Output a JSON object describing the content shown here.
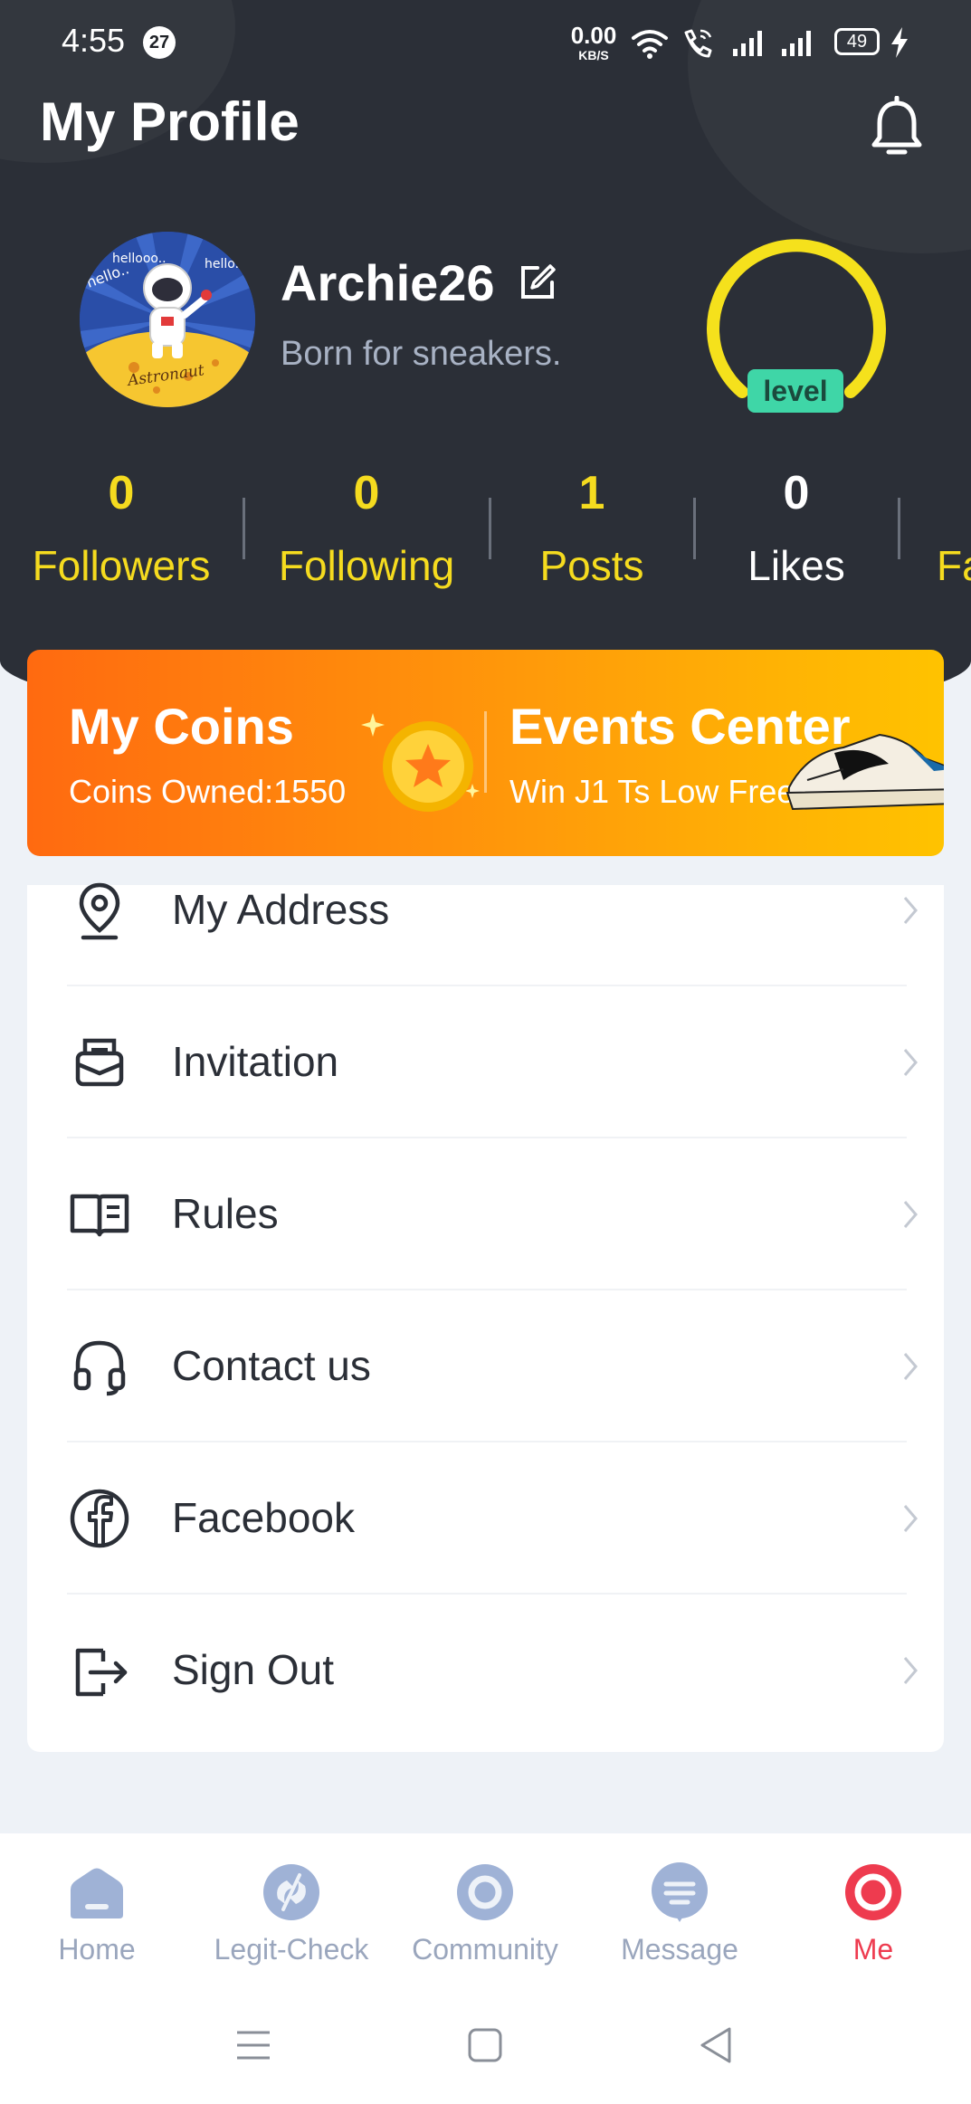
{
  "status_bar": {
    "time": "4:55",
    "notification_count": "27",
    "net_speed_value": "0.00",
    "net_speed_unit": "KB/S",
    "battery": "49"
  },
  "header": {
    "title": "My Profile"
  },
  "profile": {
    "username": "Archie26",
    "bio": "Born for sneakers.",
    "level_label": "level",
    "avatar_texts": [
      "hellooo..",
      "hello..",
      "hello..",
      "Astronaut"
    ]
  },
  "stats": [
    {
      "value": "0",
      "label": "Followers"
    },
    {
      "value": "0",
      "label": "Following"
    },
    {
      "value": "1",
      "label": "Posts"
    },
    {
      "value": "0",
      "label": "Likes"
    },
    {
      "value": "",
      "label": "Fa"
    }
  ],
  "banner": {
    "coins_title": "My Coins",
    "coins_sub": "Coins Owned:1550",
    "events_title": "Events Center",
    "events_sub": "Win J1 Ts Low Free!"
  },
  "menu": [
    {
      "label": "My Address",
      "icon": "location-pin-icon"
    },
    {
      "label": "Invitation",
      "icon": "invitation-envelope-icon"
    },
    {
      "label": "Rules",
      "icon": "book-icon"
    },
    {
      "label": "Contact us",
      "icon": "headset-icon"
    },
    {
      "label": "Facebook",
      "icon": "facebook-icon"
    },
    {
      "label": "Sign Out",
      "icon": "sign-out-icon"
    }
  ],
  "nav": [
    {
      "label": "Home",
      "icon": "home-icon"
    },
    {
      "label": "Legit-Check",
      "icon": "legit-check-icon"
    },
    {
      "label": "Community",
      "icon": "community-icon"
    },
    {
      "label": "Message",
      "icon": "message-icon"
    },
    {
      "label": "Me",
      "icon": "me-icon",
      "active": true
    }
  ],
  "colors": {
    "header_bg": "#2b2f37",
    "accent_yellow": "#f5db1f",
    "level_green": "#3fd6a7",
    "banner_orange": "#ff6a10",
    "active_red": "#ee3b4f",
    "nav_inactive": "#9aa6bd"
  }
}
